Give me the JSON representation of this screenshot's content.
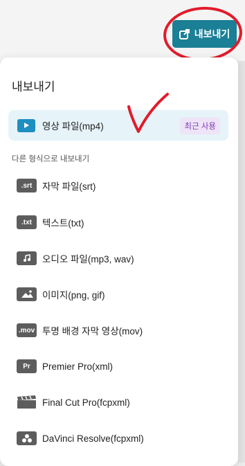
{
  "header": {
    "export_button_label": "내보내기",
    "export_button_color": "#1b7f95"
  },
  "panel": {
    "title": "내보내기",
    "primary": {
      "label": "영상 파일(mp4)",
      "badge": "최근 사용",
      "icon": "play-icon"
    },
    "section_label": "다른 형식으로 내보내기",
    "options": [
      {
        "icon_text": ".srt",
        "label": "자막 파일(srt)",
        "icon": "srt-icon"
      },
      {
        "icon_text": ".txt",
        "label": "텍스트(txt)",
        "icon": "txt-icon"
      },
      {
        "icon_text": "",
        "label": "오디오 파일(mp3, wav)",
        "icon": "music-note-icon"
      },
      {
        "icon_text": "",
        "label": "이미지(png, gif)",
        "icon": "image-icon"
      },
      {
        "icon_text": ".mov",
        "label": "투명 배경 자막 영상(mov)",
        "icon": "mov-icon"
      },
      {
        "icon_text": "Pr",
        "label": "Premier Pro(xml)",
        "icon": "premiere-icon"
      },
      {
        "icon_text": "",
        "label": "Final Cut Pro(fcpxml)",
        "icon": "clapperboard-icon"
      },
      {
        "icon_text": "",
        "label": "DaVinci Resolve(fcpxml)",
        "icon": "davinci-icon"
      }
    ]
  },
  "annotation_color": "#e21b2a"
}
